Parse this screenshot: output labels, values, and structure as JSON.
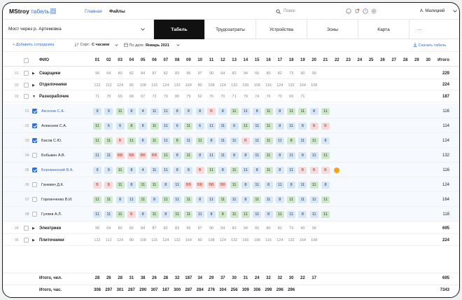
{
  "header": {
    "brand": "MStroy",
    "brand_sub": "табель",
    "nav": [
      "Главная",
      "Файлы"
    ],
    "search_placeholder": "Поиск",
    "user": "А. Малицкий"
  },
  "project": "Мост через р. Артемовка",
  "tabs": [
    "Табель",
    "Трудозатраты",
    "Устройства",
    "Зоны",
    "Карта",
    "···"
  ],
  "active_tab": 0,
  "toolbar": {
    "add": "+ Добавить сотрудника",
    "sort_label": "Сорт.:",
    "sort_value": "С часами",
    "date_label": "По дате:",
    "date_value": "Январь 2021",
    "download": "Скачать табель"
  },
  "table": {
    "name_header": "ФИО",
    "total_header": "Итого",
    "days": [
      "01",
      "02",
      "03",
      "04",
      "05",
      "06",
      "07",
      "08",
      "09",
      "10",
      "11",
      "12",
      "13",
      "14",
      "15",
      "16",
      "17",
      "18",
      "19",
      "20",
      "21",
      "22",
      "23",
      "24",
      "25",
      "26",
      "27",
      "28",
      "29",
      "30"
    ],
    "groups_top": [
      {
        "num": "01",
        "name": "Сварщики",
        "values": [
          "96",
          "64",
          "80",
          "82",
          "84",
          "87",
          "82",
          "83",
          "96",
          "97",
          "90",
          "64",
          "82",
          "94",
          "65",
          "80",
          "82",
          "73",
          "90",
          "99"
        ],
        "total": "229",
        "bold": true
      },
      {
        "num": "02",
        "name": "Отделочники",
        "values": [
          "122",
          "112",
          "124",
          "80",
          "108",
          "116",
          "124",
          "132",
          "164",
          "80",
          "108",
          "124",
          "132",
          "165",
          "108",
          "116",
          "124",
          "132",
          "164",
          "108"
        ],
        "total": "224",
        "bold": true
      },
      {
        "num": "03",
        "name": "Разнорабочие",
        "values": [
          "71",
          "78",
          "69",
          "68",
          "67",
          "72",
          "79",
          "80",
          "79",
          "62",
          "76",
          "70",
          "71",
          "79",
          "74",
          "76",
          "70",
          "69",
          "71"
        ],
        "total": "187",
        "bold": true,
        "expanded": true
      }
    ],
    "people": [
      {
        "num": "01",
        "name": "Аксенов С.А.",
        "checked": true,
        "link": true,
        "marks": [
          "9n",
          "9n",
          "11g",
          "8n",
          "4n",
          "11n",
          "11n",
          "8n",
          "8n",
          "8n",
          "В",
          "8n",
          "11g",
          "11n",
          "8n",
          "11g",
          "8n",
          "11g",
          "11g",
          "8n",
          "11g"
        ],
        "total": "116"
      },
      {
        "num": "02",
        "name": "Алексеев С.А.",
        "checked": true,
        "link": false,
        "marks": [
          "11g",
          "6n",
          "6n",
          "8g",
          "8n",
          "11g",
          "11n",
          "6n",
          "11g",
          "6n",
          "11n",
          "11n",
          "6n",
          "11g",
          "11n",
          "11g",
          "8n",
          "11n",
          "8n",
          "В",
          "В"
        ],
        "total": "114"
      },
      {
        "num": "03",
        "name": "Басов С.Ю.",
        "checked": true,
        "link": false,
        "marks": [
          "11g",
          "11g",
          "В",
          "11g",
          "8n",
          "11g",
          "11n",
          "8g",
          "11n",
          "11g",
          "8n",
          "11n",
          "11n",
          "В",
          "11n",
          "11g",
          "11n",
          "8g",
          "11n",
          "11g",
          "8n"
        ],
        "total": "124"
      },
      {
        "num": "04",
        "name": "Бобыкин А.В.",
        "checked": false,
        "link": false,
        "marks": [
          "11n",
          "11n",
          "ВВ",
          "ВВ",
          "ВВ",
          "ВВ",
          "11g",
          "8n",
          "11g",
          "8n",
          "11n",
          "11n",
          "8n",
          "8n",
          "11n",
          "11g",
          "8n",
          "11n",
          "8n",
          "11n",
          "11g"
        ],
        "total": "132"
      },
      {
        "num": "05",
        "name": "Бороминский В.А.",
        "checked": true,
        "link": true,
        "marks": [
          "9n",
          "9n",
          "11g",
          "8n",
          "4n",
          "11n",
          "11n",
          "8n",
          "8n",
          "В",
          "11g",
          "8n",
          "11g",
          "11n",
          "8n",
          "11g",
          "8n",
          "11n",
          "В",
          "В",
          "В",
          "o"
        ],
        "total": "116"
      },
      {
        "num": "06",
        "name": "Ганевич Д.К.",
        "checked": false,
        "link": false,
        "marks": [
          "В",
          "В",
          "11g",
          "8n",
          "11g",
          "11g",
          "8n",
          "11n",
          "ВВ",
          "ВВ",
          "ВВ",
          "ВВ",
          "11g",
          "8n",
          "11n",
          "8n",
          "11n",
          "8n",
          "11n",
          "11g",
          "8n"
        ],
        "total": "124"
      },
      {
        "num": "07",
        "name": "Горлинченко В.И.",
        "checked": false,
        "link": false,
        "marks": [
          "11g",
          "11g",
          "8n",
          "11n",
          "11g",
          "8n",
          "11g",
          "11n",
          "11g",
          "8n",
          "11n",
          "11g",
          "11n",
          "8n",
          "11g",
          "11n",
          "8n",
          "11g",
          "11n",
          "11n",
          "11g"
        ],
        "total": "164"
      },
      {
        "num": "08",
        "name": "Гуляев А.Л.",
        "checked": false,
        "link": false,
        "marks": [
          "11n",
          "11n",
          "11g",
          "В",
          "8n",
          "11g",
          "8n",
          "11g",
          "11g",
          "11n",
          "8n",
          "8g",
          "11g",
          "11g",
          "11n",
          "8n",
          "11g",
          "11n",
          "8n",
          "11n",
          "11g"
        ],
        "total": "118"
      }
    ],
    "groups_bottom": [
      {
        "num": "04",
        "name": "Электрики",
        "values": [
          "96",
          "64",
          "80",
          "82",
          "84",
          "87",
          "82",
          "83",
          "96",
          "97",
          "90",
          "64",
          "82",
          "94",
          "65",
          "80",
          "82",
          "73",
          "90",
          "99"
        ],
        "total": "695",
        "bold": true
      },
      {
        "num": "05",
        "name": "Плиточники",
        "values": [
          "122",
          "112",
          "124",
          "80",
          "108",
          "116",
          "124",
          "132",
          "164",
          "80",
          "108",
          "124",
          "132",
          "165",
          "108",
          "116",
          "124",
          "132",
          "164",
          "108"
        ],
        "total": "224",
        "bold": true
      }
    ],
    "footer": [
      {
        "label": "Итого, чел.",
        "values": [
          "28",
          "26",
          "28",
          "31",
          "38",
          "26",
          "28",
          "32",
          "187",
          "34",
          "29",
          "37",
          "30",
          "31",
          "24",
          "32",
          "32",
          "30",
          "22",
          "17"
        ],
        "total": "695"
      },
      {
        "label": "Итого, час.",
        "values": [
          "308",
          "297",
          "301",
          "287",
          "290",
          "307",
          "187",
          "300",
          "287",
          "284",
          "276",
          "304",
          "256",
          "309",
          "306",
          "299",
          "296",
          "296"
        ],
        "total": "7343"
      }
    ]
  }
}
